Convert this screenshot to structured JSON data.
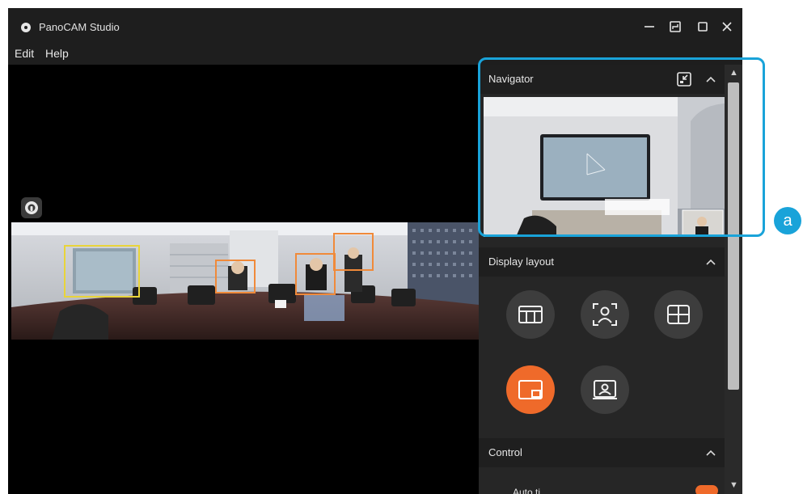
{
  "app": {
    "title": "PanoCAM Studio"
  },
  "window_controls": {
    "minimize": "minimize-icon",
    "restore": "restore-icon",
    "maximize": "maximize-icon",
    "close": "close-icon"
  },
  "menu": {
    "items": [
      "Edit",
      "Help"
    ]
  },
  "navigator": {
    "title": "Navigator"
  },
  "display_layout": {
    "title": "Display layout",
    "options": [
      {
        "icon": "panorama-table-icon",
        "active": false
      },
      {
        "icon": "speaker-focus-icon",
        "active": false
      },
      {
        "icon": "grid-quad-icon",
        "active": false
      },
      {
        "icon": "picture-in-picture-icon",
        "active": true
      },
      {
        "icon": "presenter-icon",
        "active": false
      }
    ]
  },
  "control": {
    "title": "Control",
    "partial_label": "Auto ti..."
  },
  "callout": {
    "label": "a"
  },
  "colors": {
    "accent": "#ef6a2a",
    "callout": "#19a3d9",
    "detect_speaker": "#f08a3a",
    "detect_screen": "#e8d43a"
  }
}
